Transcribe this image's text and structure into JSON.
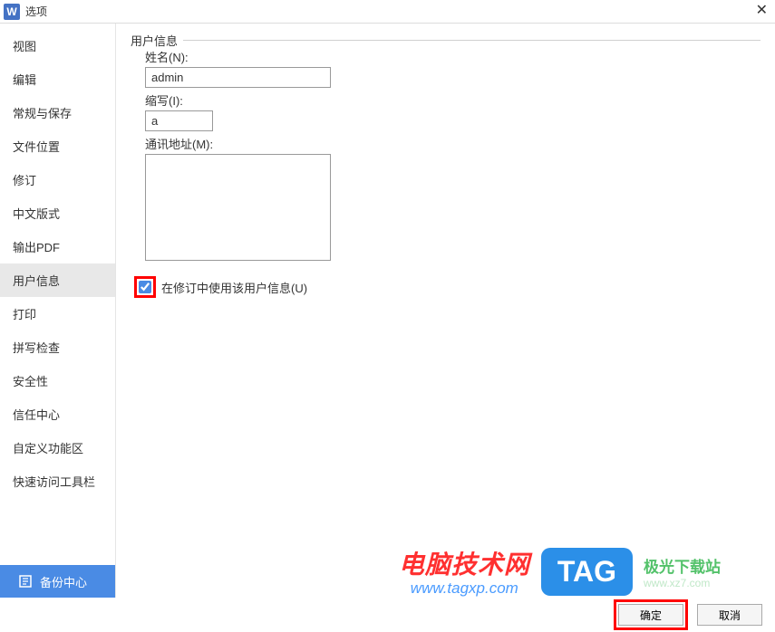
{
  "window": {
    "title": "选项",
    "icon_letter": "W"
  },
  "sidebar": {
    "items": [
      {
        "label": "视图"
      },
      {
        "label": "编辑"
      },
      {
        "label": "常规与保存"
      },
      {
        "label": "文件位置"
      },
      {
        "label": "修订"
      },
      {
        "label": "中文版式"
      },
      {
        "label": "输出PDF"
      },
      {
        "label": "用户信息"
      },
      {
        "label": "打印"
      },
      {
        "label": "拼写检查"
      },
      {
        "label": "安全性"
      },
      {
        "label": "信任中心"
      },
      {
        "label": "自定义功能区"
      },
      {
        "label": "快速访问工具栏"
      }
    ],
    "active_index": 7,
    "backup_center": "备份中心"
  },
  "content": {
    "group_title": "用户信息",
    "name_label": "姓名(N):",
    "name_value": "admin",
    "initials_label": "缩写(I):",
    "initials_value": "a",
    "address_label": "通讯地址(M):",
    "address_value": "",
    "checkbox_label": "在修订中使用该用户信息(U)",
    "checkbox_checked": true
  },
  "footer": {
    "ok": "确定",
    "cancel": "取消"
  },
  "watermarks": {
    "wm1_line1": "电脑技术网",
    "wm1_line2": "www.tagxp.com",
    "wm2": "TAG",
    "wm3_line1": "极光下载站",
    "wm3_line2": "www.xz7.com"
  }
}
